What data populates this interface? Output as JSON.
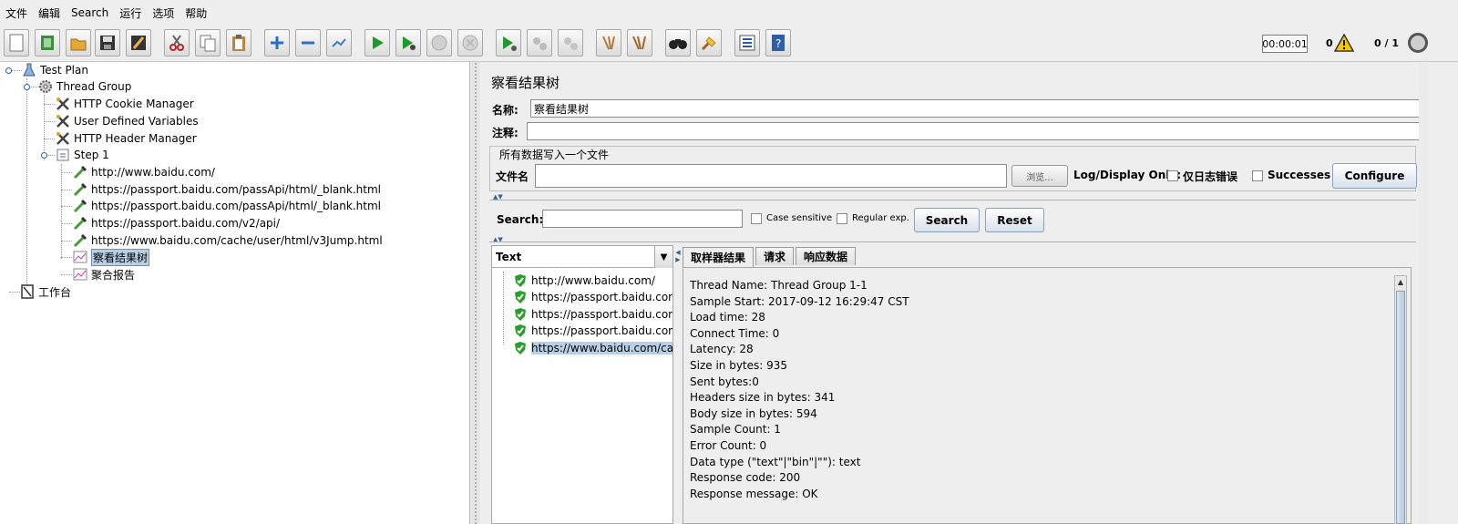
{
  "menu": [
    "文件",
    "编辑",
    "Search",
    "运行",
    "选项",
    "帮助"
  ],
  "toolbar": {
    "timer": "00:00:01",
    "error_count": "0",
    "threads": "0 / 1"
  },
  "tree": {
    "test_plan": "Test Plan",
    "thread_group": "Thread Group",
    "cookie_manager": "HTTP Cookie Manager",
    "user_vars": "User Defined Variables",
    "header_manager": "HTTP Header Manager",
    "step1": "Step 1",
    "samplers": [
      "http://www.baidu.com/",
      "https://passport.baidu.com/passApi/html/_blank.html",
      "https://passport.baidu.com/passApi/html/_blank.html",
      "https://passport.baidu.com/v2/api/",
      "https://www.baidu.com/cache/user/html/v3Jump.html"
    ],
    "view_results": "察看结果树",
    "aggregate": "聚合报告",
    "workbench": "工作台"
  },
  "panel": {
    "title": "察看结果树",
    "name_label": "名称:",
    "name_value": "察看结果树",
    "comment_label": "注释:",
    "comment_value": "",
    "file_group_title": "所有数据写入一个文件",
    "file_label": "文件名",
    "file_value": "",
    "browse": "浏览...",
    "log_display": "Log/Display Only:",
    "errors_only": "仅日志错误",
    "successes": "Successes",
    "configure": "Configure"
  },
  "search": {
    "label": "Search:",
    "value": "",
    "case_sensitive": "Case sensitive",
    "regular_exp": "Regular exp.",
    "search_btn": "Search",
    "reset_btn": "Reset"
  },
  "results": {
    "renderer": "Text",
    "items": [
      "http://www.baidu.com/",
      "https://passport.baidu.com/p",
      "https://passport.baidu.com/p",
      "https://passport.baidu.com/v",
      "https://www.baidu.com/cach"
    ]
  },
  "tabs": [
    "取样器结果",
    "请求",
    "响应数据"
  ],
  "detail_lines": [
    "Thread Name: Thread Group 1-1",
    "Sample Start: 2017-09-12 16:29:47 CST",
    "Load time: 28",
    "Connect Time: 0",
    "Latency: 28",
    "Size in bytes: 935",
    "Sent bytes:0",
    "Headers size in bytes: 341",
    "Body size in bytes: 594",
    "Sample Count: 1",
    "Error Count: 0",
    "Data type (\"text\"|\"bin\"|\"\"): text",
    "Response code: 200",
    "Response message: OK"
  ],
  "colors": {
    "selection": "#b8cfe5",
    "success_shield": "#2a9d2a",
    "button_border": "#8aa0bb"
  }
}
